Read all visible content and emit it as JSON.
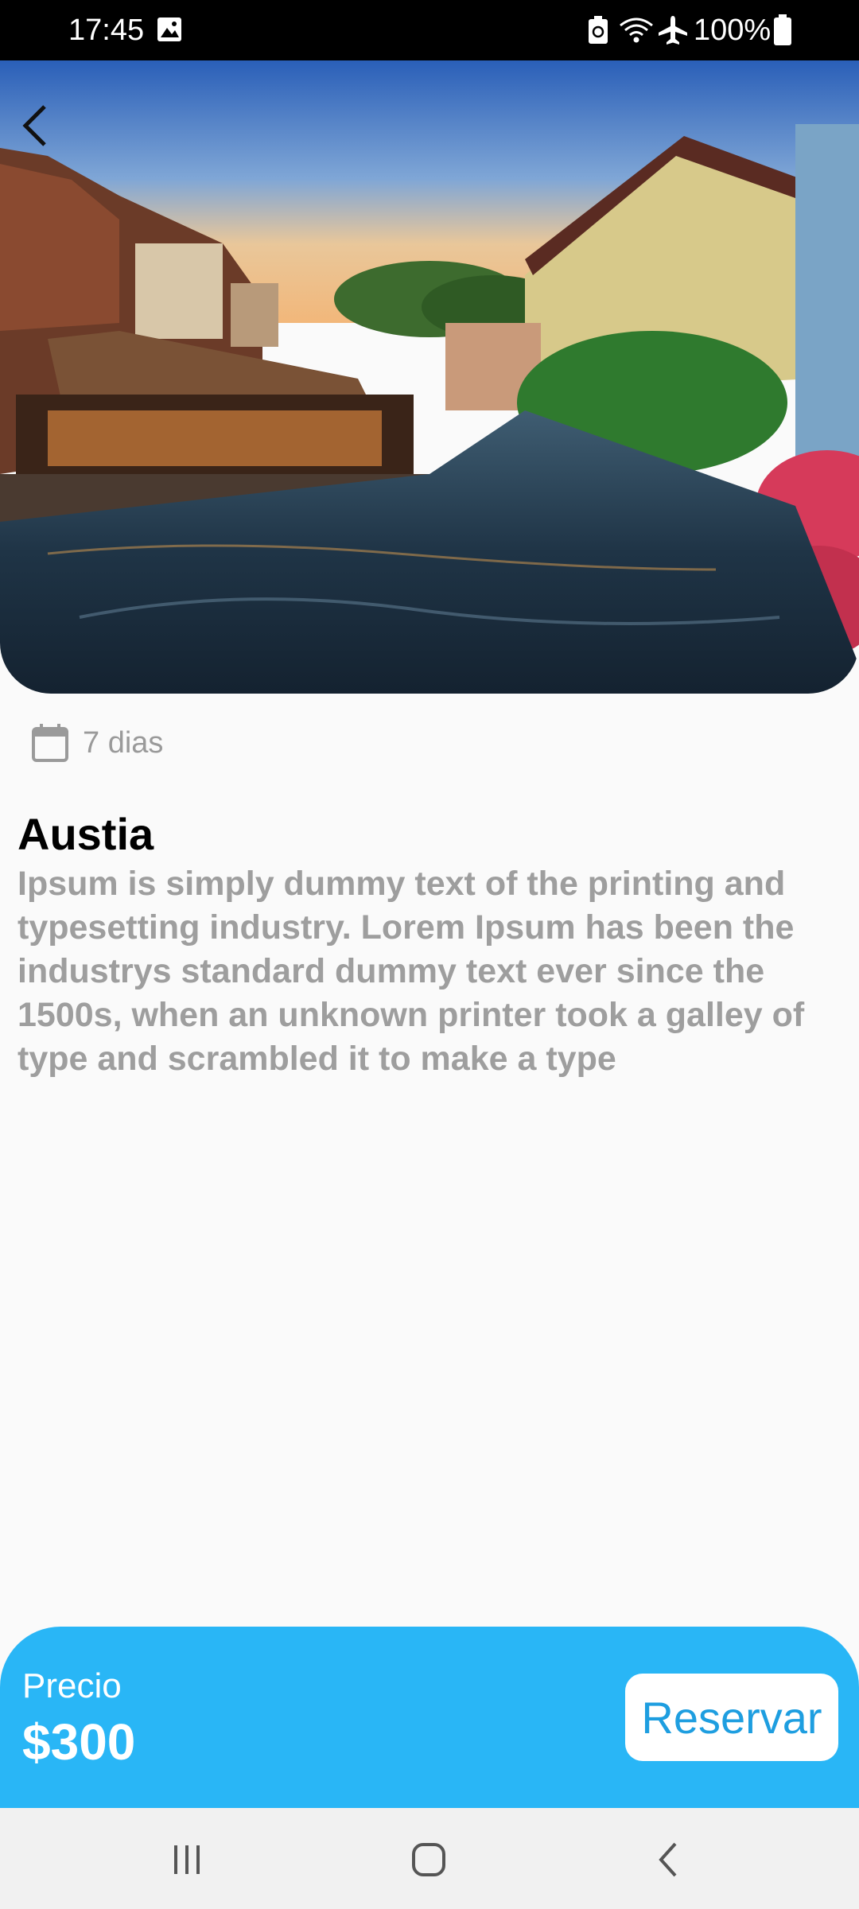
{
  "status_bar": {
    "time": "17:45",
    "battery": "100%",
    "icons": [
      "gallery-icon",
      "battery-saver-icon",
      "wifi-icon",
      "airplane-mode-icon",
      "battery-icon"
    ]
  },
  "hero": {
    "image": "canal-town-photo",
    "back_icon": "back-arrow-icon"
  },
  "trip": {
    "duration_icon": "calendar-icon",
    "duration": "7 dias",
    "title": "Austia",
    "description": "Ipsum is simply dummy text of the printing and typesetting industry. Lorem Ipsum has been the industrys standard dummy text ever since the 1500s, when an unknown printer took a galley of type and scrambled it to make a type"
  },
  "price_bar": {
    "label": "Precio",
    "value": "$300",
    "button_label": "Reservar",
    "color": "#29b6f6"
  },
  "nav_bar": {
    "icons": [
      "recent-apps-icon",
      "home-icon",
      "back-icon"
    ]
  }
}
